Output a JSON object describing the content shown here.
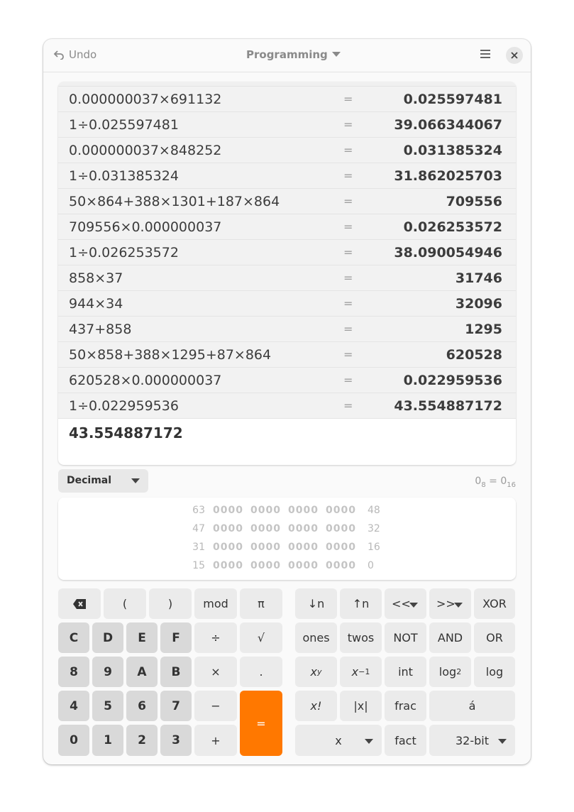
{
  "header": {
    "undo_label": "Undo",
    "mode_label": "Programming"
  },
  "history": [
    {
      "expr": "0.000000037×691132",
      "eq": "=",
      "result": "0.025597481"
    },
    {
      "expr": "1÷0.025597481",
      "eq": "=",
      "result": "39.066344067"
    },
    {
      "expr": "0.000000037×848252",
      "eq": "=",
      "result": "0.031385324"
    },
    {
      "expr": "1÷0.031385324",
      "eq": "=",
      "result": "31.862025703"
    },
    {
      "expr": "50×864+388×1301+187×864",
      "eq": "=",
      "result": "709556"
    },
    {
      "expr": "709556×0.000000037",
      "eq": "=",
      "result": "0.026253572"
    },
    {
      "expr": "1÷0.026253572",
      "eq": "=",
      "result": "38.090054946"
    },
    {
      "expr": "858×37",
      "eq": "=",
      "result": "31746"
    },
    {
      "expr": "944×34",
      "eq": "=",
      "result": "32096"
    },
    {
      "expr": "437+858",
      "eq": "=",
      "result": "1295"
    },
    {
      "expr": "50×858+388×1295+87×864",
      "eq": "=",
      "result": "620528"
    },
    {
      "expr": "620528×0.000000037",
      "eq": "=",
      "result": "0.022959536"
    },
    {
      "expr": "1÷0.022959536",
      "eq": "=",
      "result": "43.554887172"
    }
  ],
  "current_value": "43.554887172",
  "base_select": "Decimal",
  "conversion": {
    "a": "0",
    "a_sub": "8",
    "eq": " = ",
    "b": "0",
    "b_sub": "16"
  },
  "bits": [
    {
      "left": "63",
      "nibbles": [
        "0000",
        "0000",
        "0000",
        "0000"
      ],
      "right": "48"
    },
    {
      "left": "47",
      "nibbles": [
        "0000",
        "0000",
        "0000",
        "0000"
      ],
      "right": "32"
    },
    {
      "left": "31",
      "nibbles": [
        "0000",
        "0000",
        "0000",
        "0000"
      ],
      "right": "16"
    },
    {
      "left": "15",
      "nibbles": [
        "0000",
        "0000",
        "0000",
        "0000"
      ],
      "right": "0"
    }
  ],
  "keys": {
    "backspace_icon": "backspace-icon",
    "lparen": "(",
    "rparen": ")",
    "mod": "mod",
    "pi": "π",
    "c": "C",
    "d": "D",
    "e": "E",
    "f": "F",
    "divide": "÷",
    "sqrt": "√",
    "n8": "8",
    "n9": "9",
    "a": "A",
    "b": "B",
    "multiply": "×",
    "dot": ".",
    "n4": "4",
    "n5": "5",
    "n6": "6",
    "n7": "7",
    "minus": "−",
    "equals": "=",
    "n0": "0",
    "n1": "1",
    "n2": "2",
    "n3": "3",
    "plus": "+",
    "shift_down": "↓n",
    "shift_up": "↑n",
    "shl": "<<",
    "shr": ">>",
    "xor": "XOR",
    "ones": "ones",
    "twos": "twos",
    "not": "NOT",
    "and": "AND",
    "or": "OR",
    "pow_base": "x",
    "pow_exp": "y",
    "inv_base": "x",
    "inv_exp": "−1",
    "int": "int",
    "log2_base": "log",
    "log2_sub": "2",
    "log": "log",
    "fact_x": "x!",
    "abs": "|x|",
    "frac": "frac",
    "char": "á",
    "x_select": "x",
    "fact": "fact",
    "wordsize": "32-bit"
  },
  "colors": {
    "accent": "#ff7800"
  }
}
